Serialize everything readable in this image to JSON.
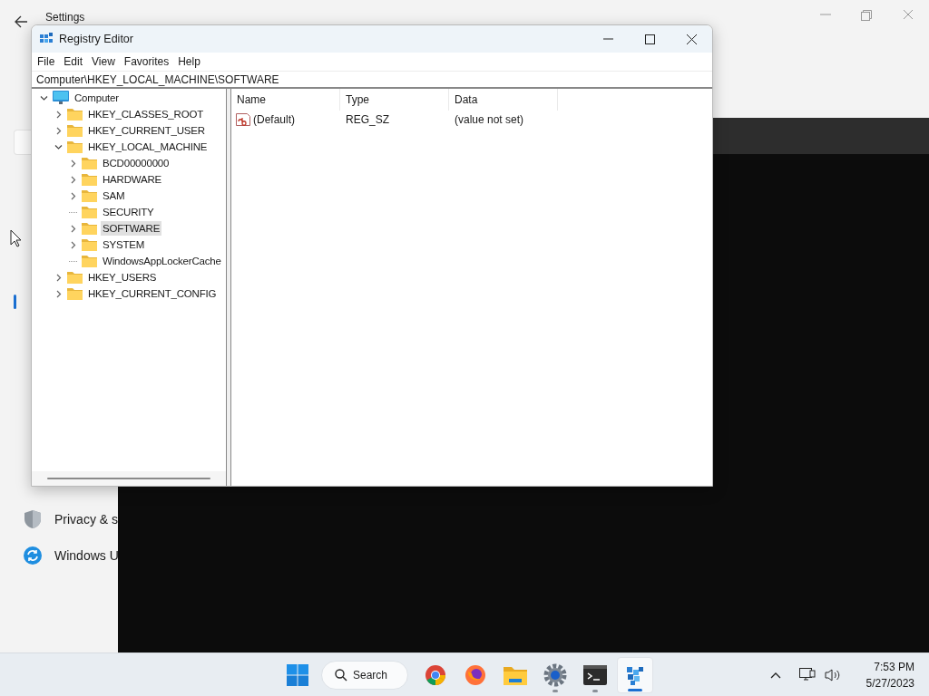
{
  "settings_window": {
    "title": "Settings",
    "nav_items": [
      {
        "label": "Privacy & s",
        "kind": "shield"
      },
      {
        "label": "Windows U",
        "kind": "update"
      }
    ]
  },
  "registry_editor": {
    "title": "Registry Editor",
    "menu": [
      "File",
      "Edit",
      "View",
      "Favorites",
      "Help"
    ],
    "address": "Computer\\HKEY_LOCAL_MACHINE\\SOFTWARE",
    "tree": {
      "label": "Computer",
      "kind": "computer",
      "expandable": true,
      "expanded": true,
      "selected": false,
      "children": [
        {
          "label": "HKEY_CLASSES_ROOT",
          "kind": "folder",
          "expandable": true,
          "expanded": false,
          "selected": false
        },
        {
          "label": "HKEY_CURRENT_USER",
          "kind": "folder",
          "expandable": true,
          "expanded": false,
          "selected": false
        },
        {
          "label": "HKEY_LOCAL_MACHINE",
          "kind": "folder",
          "expandable": true,
          "expanded": true,
          "selected": false,
          "children": [
            {
              "label": "BCD00000000",
              "kind": "folder",
              "expandable": true,
              "expanded": false,
              "selected": false
            },
            {
              "label": "HARDWARE",
              "kind": "folder",
              "expandable": true,
              "expanded": false,
              "selected": false
            },
            {
              "label": "SAM",
              "kind": "folder",
              "expandable": true,
              "expanded": false,
              "selected": false
            },
            {
              "label": "SECURITY",
              "kind": "folder",
              "expandable": false,
              "expanded": false,
              "selected": false
            },
            {
              "label": "SOFTWARE",
              "kind": "folder",
              "expandable": true,
              "expanded": false,
              "selected": true
            },
            {
              "label": "SYSTEM",
              "kind": "folder",
              "expandable": true,
              "expanded": false,
              "selected": false
            },
            {
              "label": "WindowsAppLockerCache",
              "kind": "folder",
              "expandable": false,
              "expanded": false,
              "selected": false
            }
          ]
        },
        {
          "label": "HKEY_USERS",
          "kind": "folder",
          "expandable": true,
          "expanded": false,
          "selected": false
        },
        {
          "label": "HKEY_CURRENT_CONFIG",
          "kind": "folder",
          "expandable": true,
          "expanded": false,
          "selected": false
        }
      ]
    },
    "columns": [
      "Name",
      "Type",
      "Data"
    ],
    "rows": [
      {
        "name": "(Default)",
        "type": "REG_SZ",
        "data": "(value not set)"
      }
    ]
  },
  "taskbar": {
    "search": "Search",
    "apps": [
      {
        "kind": "chrome",
        "running": false,
        "selected": false
      },
      {
        "kind": "firefox",
        "running": false,
        "selected": false
      },
      {
        "kind": "explorer",
        "running": false,
        "selected": false
      },
      {
        "kind": "settings",
        "running": true,
        "selected": false
      },
      {
        "kind": "terminal",
        "running": true,
        "selected": false
      },
      {
        "kind": "regedit",
        "running": true,
        "selected": true
      }
    ],
    "time": "7:53 PM",
    "date": "5/27/2023"
  }
}
